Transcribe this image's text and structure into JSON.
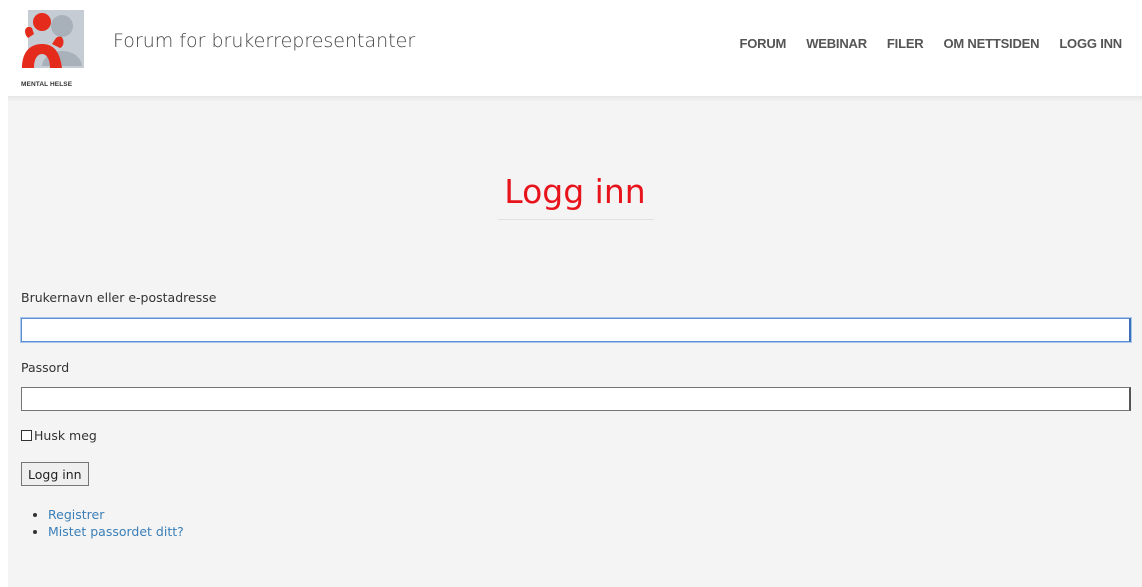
{
  "header": {
    "logo_text": "MENTAL HELSE",
    "site_title": "Forum for brukerrepresentanter",
    "nav": [
      {
        "label": "FORUM"
      },
      {
        "label": "WEBINAR"
      },
      {
        "label": "FILER"
      },
      {
        "label": "OM NETTSIDEN"
      },
      {
        "label": "LOGG INN"
      }
    ]
  },
  "login": {
    "title": "Logg inn",
    "username_label": "Brukernavn eller e-postadresse",
    "username_value": "",
    "password_label": "Passord",
    "password_value": "",
    "remember_label": "Husk meg",
    "remember_checked": false,
    "submit_label": "Logg inn",
    "links": [
      {
        "label": "Registrer"
      },
      {
        "label": "Mistet passordet ditt?"
      }
    ]
  },
  "colors": {
    "accent": "#e8141c",
    "link": "#3a7fb8",
    "content_bg": "#f4f4f4"
  }
}
